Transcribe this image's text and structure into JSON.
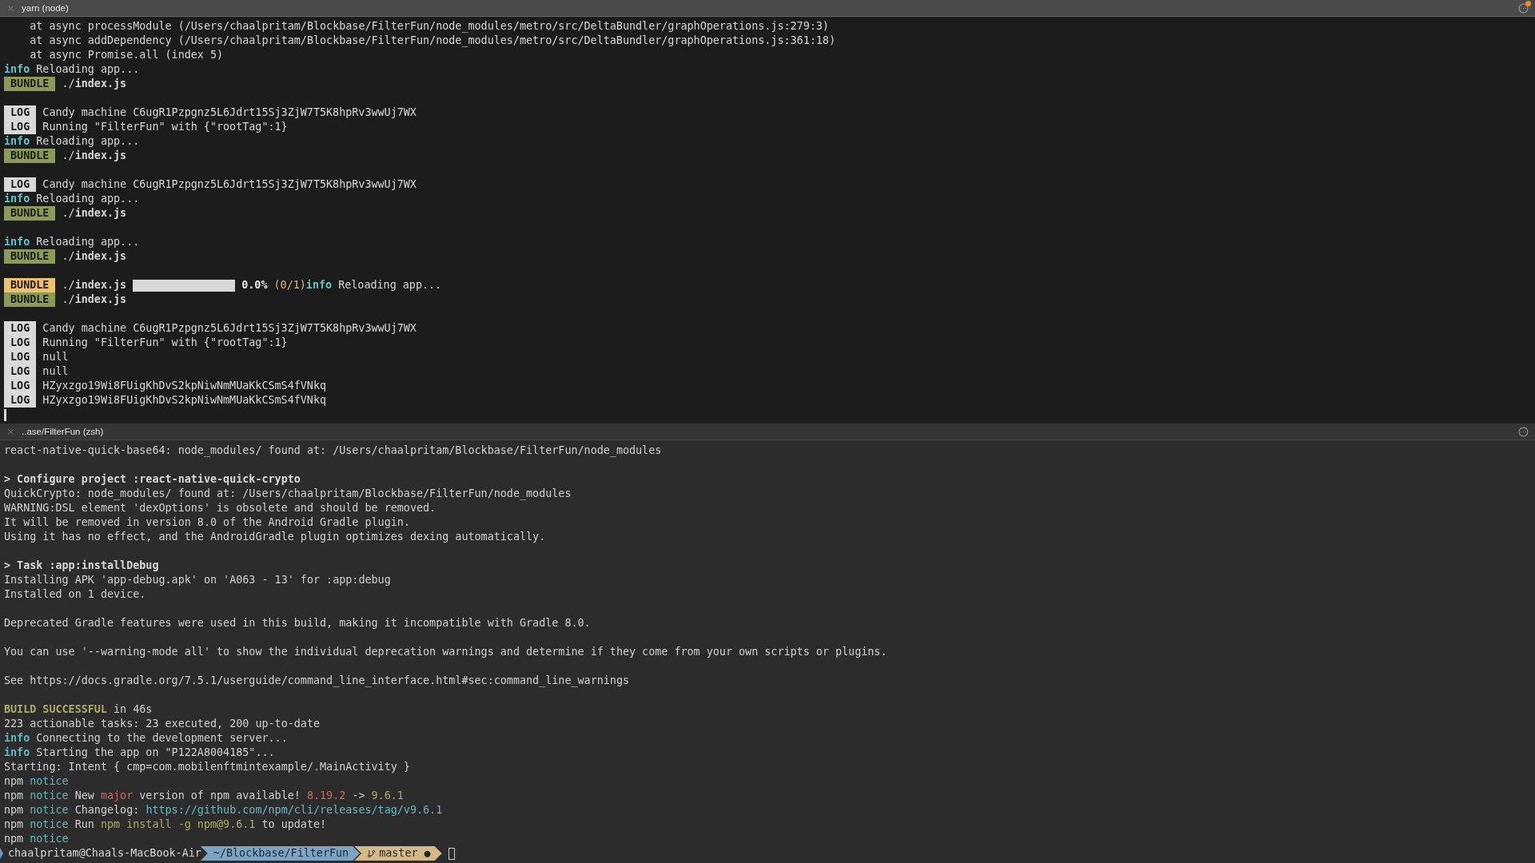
{
  "top_pane": {
    "title": "yarn (node)",
    "unread": true,
    "blocks": [
      [
        {
          "kind": "trace",
          "text": "at async processModule (/Users/chaalpritam/Blockbase/FilterFun/node_modules/metro/src/DeltaBundler/graphOperations.js:279:3)"
        },
        {
          "kind": "trace",
          "text": "at async addDependency (/Users/chaalpritam/Blockbase/FilterFun/node_modules/metro/src/DeltaBundler/graphOperations.js:361:18)"
        },
        {
          "kind": "trace",
          "text": "at async Promise.all (index 5)"
        },
        {
          "kind": "info",
          "tag": "info",
          "text": "Reloading app..."
        },
        {
          "kind": "bundle",
          "tag": "BUNDLE",
          "running": false,
          "text": "./**index.js**"
        }
      ],
      [
        {
          "kind": "log",
          "tag": "LOG",
          "text": "Candy machine C6ugR1Pzpgnz5L6Jdrt15Sj3ZjW7T5K8hpRv3wwUj7WX"
        },
        {
          "kind": "log",
          "tag": "LOG",
          "text": "Running \"FilterFun\" with {\"rootTag\":1}"
        },
        {
          "kind": "info",
          "tag": "info",
          "text": "Reloading app..."
        },
        {
          "kind": "bundle",
          "tag": "BUNDLE",
          "running": false,
          "text": "./**index.js**"
        }
      ],
      [
        {
          "kind": "log",
          "tag": "LOG",
          "text": "Candy machine C6ugR1Pzpgnz5L6Jdrt15Sj3ZjW7T5K8hpRv3wwUj7WX"
        },
        {
          "kind": "info",
          "tag": "info",
          "text": "Reloading app..."
        },
        {
          "kind": "bundle",
          "tag": "BUNDLE",
          "running": false,
          "text": "./**index.js**"
        }
      ],
      [
        {
          "kind": "info",
          "tag": "info",
          "text": "Reloading app..."
        },
        {
          "kind": "bundle",
          "tag": "BUNDLE",
          "running": false,
          "text": "./**index.js**"
        }
      ],
      [
        {
          "kind": "progress",
          "tag": "BUNDLE",
          "running": true,
          "text": "./**index.js**",
          "level": 0,
          "percent": "0.0%",
          "count": "(0/1)",
          "info_tag": "info",
          "info_text": "Reloading app..."
        },
        {
          "kind": "bundle",
          "tag": "BUNDLE",
          "running": false,
          "text": "./**index.js**"
        }
      ],
      [
        {
          "kind": "log",
          "tag": "LOG",
          "text": "Candy machine C6ugR1Pzpgnz5L6Jdrt15Sj3ZjW7T5K8hpRv3wwUj7WX"
        },
        {
          "kind": "log",
          "tag": "LOG",
          "text": "Running \"FilterFun\" with {\"rootTag\":1}"
        },
        {
          "kind": "log",
          "tag": "LOG",
          "text": "null"
        },
        {
          "kind": "log",
          "tag": "LOG",
          "text": "null"
        },
        {
          "kind": "log",
          "tag": "LOG",
          "text": "HZyxzgo19Wi8FUigKhDvS2kpNiwNmMUaKkCSmS4fVNkq"
        },
        {
          "kind": "log",
          "tag": "LOG",
          "text": "HZyxzgo19Wi8FUigKhDvS2kpNiwNmMUaKkCSmS4fVNkq"
        },
        {
          "kind": "cursor"
        }
      ]
    ]
  },
  "bottom_pane": {
    "title": "..ase/FilterFun (zsh)",
    "unread": false,
    "blocks": [
      [
        [
          {
            "kind": "plain",
            "text": "react-native-quick-base64: node_modules/ found at: /Users/chaalpritam/Blockbase/FilterFun/node_modules"
          }
        ]
      ],
      [
        [
          {
            "kind": "bold",
            "text": "> Configure project :react-native-quick-crypto"
          }
        ],
        [
          {
            "kind": "plain",
            "text": "QuickCrypto: node_modules/ found at: /Users/chaalpritam/Blockbase/FilterFun/node_modules"
          }
        ],
        [
          {
            "kind": "plain",
            "text": "WARNING:DSL element 'dexOptions' is obsolete and should be removed."
          }
        ],
        [
          {
            "kind": "plain",
            "text": "It will be removed in version 8.0 of the Android Gradle plugin."
          }
        ],
        [
          {
            "kind": "plain",
            "text": "Using it has no effect, and the AndroidGradle plugin optimizes dexing automatically."
          }
        ]
      ],
      [
        [
          {
            "kind": "bold",
            "text": "> Task :app:installDebug"
          }
        ],
        [
          {
            "kind": "plain",
            "text": "Installing APK 'app-debug.apk' on 'A063 - 13' for :app:debug"
          }
        ],
        [
          {
            "kind": "plain",
            "text": "Installed on 1 device."
          }
        ]
      ],
      [
        [
          {
            "kind": "plain",
            "text": "Deprecated Gradle features were used in this build, making it incompatible with Gradle 8.0."
          }
        ]
      ],
      [
        [
          {
            "kind": "plain",
            "text": "You can use '--warning-mode all' to show the individual deprecation warnings and determine if they come from your own scripts or plugins."
          }
        ]
      ],
      [
        [
          {
            "kind": "plain",
            "text": "See https://docs.gradle.org/7.5.1/userguide/command_line_interface.html#sec:command_line_warnings"
          }
        ]
      ],
      [
        [
          {
            "kind": "success",
            "text": "BUILD SUCCESSFUL"
          },
          {
            "kind": "plain",
            "text": " in 46s"
          }
        ],
        [
          {
            "kind": "plain",
            "text": "223 actionable tasks: 23 executed, 200 up-to-date"
          }
        ],
        [
          {
            "kind": "info",
            "text": "info"
          },
          {
            "kind": "plain",
            "text": " Connecting to the development server..."
          }
        ],
        [
          {
            "kind": "info",
            "text": "info"
          },
          {
            "kind": "plain",
            "text": " Starting the app on \"P122A8004185\"..."
          }
        ],
        [
          {
            "kind": "plain",
            "text": "Starting: Intent { cmp=com.mobilenftmintexample/.MainActivity }"
          }
        ],
        [
          {
            "kind": "plain",
            "text": "npm "
          },
          {
            "kind": "notice",
            "text": "notice"
          }
        ],
        [
          {
            "kind": "plain",
            "text": "npm "
          },
          {
            "kind": "notice",
            "text": "notice"
          },
          {
            "kind": "plain",
            "text": " New "
          },
          {
            "kind": "red",
            "text": "major"
          },
          {
            "kind": "plain",
            "text": " version of npm available! "
          },
          {
            "kind": "red",
            "text": "8.19.2"
          },
          {
            "kind": "plain",
            "text": " -> "
          },
          {
            "kind": "green",
            "text": "9.6.1"
          }
        ],
        [
          {
            "kind": "plain",
            "text": "npm "
          },
          {
            "kind": "notice",
            "text": "notice"
          },
          {
            "kind": "plain",
            "text": " Changelog: "
          },
          {
            "kind": "link",
            "text": "https://github.com/npm/cli/releases/tag/v9.6.1"
          }
        ],
        [
          {
            "kind": "plain",
            "text": "npm "
          },
          {
            "kind": "notice",
            "text": "notice"
          },
          {
            "kind": "plain",
            "text": " Run "
          },
          {
            "kind": "green",
            "text": "npm install -g npm@9.6.1"
          },
          {
            "kind": "plain",
            "text": " to update!"
          }
        ],
        [
          {
            "kind": "plain",
            "text": "npm "
          },
          {
            "kind": "notice",
            "text": "notice"
          }
        ]
      ]
    ],
    "prompt": {
      "user": "chaalpritam@Chaals-MacBook-Air",
      "path": "~/Blockbase/FilterFun",
      "branch": "master",
      "dirty_marker": "●"
    }
  }
}
